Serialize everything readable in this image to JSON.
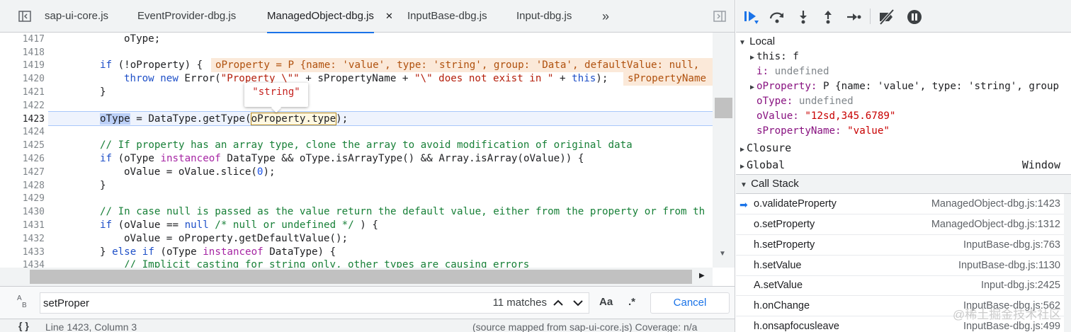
{
  "tabs": [
    {
      "label": "sap-ui-core.js"
    },
    {
      "label": "EventProvider-dbg.js"
    },
    {
      "label": "ManagedObject-dbg.js",
      "close": "✕"
    },
    {
      "label": "InputBase-dbg.js"
    },
    {
      "label": "Input-dbg.js"
    }
  ],
  "tabs_overflow": "»",
  "editor": {
    "line_numbers": [
      "1417",
      "1418",
      "1419",
      "1420",
      "1421",
      "1422",
      "1423",
      "1424",
      "1425",
      "1426",
      "1427",
      "1428",
      "1429",
      "1430",
      "1431",
      "1432",
      "1433",
      "1434"
    ],
    "inline_value_1": "oProperty = P {name: 'value', type: 'string', group: 'Data', defaultValue: null,",
    "inline_value_2": "sPropertyName",
    "tooltip": "\"string\"",
    "code": {
      "l1417": "oType;",
      "l1419a": "if",
      "l1419b": " (!oProperty) {",
      "l1420a": "throw new",
      "l1420b": " Error(",
      "l1420c": "\"Property \\\"\"",
      "l1420d": " + sPropertyName + ",
      "l1420e": "\"\\\" does not exist in \"",
      "l1420f": " + ",
      "l1420g": "this",
      "l1420h": ");",
      "l1421": "}",
      "l1423a": "oType",
      "l1423b": " = DataType.getType(",
      "l1423c": "oProperty.type",
      "l1423d": ");",
      "l1425": "// If property has an array type, clone the array to avoid modification of original data",
      "l1426a": "if",
      "l1426b": " (oType ",
      "l1426c": "instanceof",
      "l1426d": " DataType && oType.isArrayType() && Array.isArray(oValue)) {",
      "l1427a": "oValue = oValue.slice(",
      "l1427b": "0",
      "l1427c": ");",
      "l1428": "}",
      "l1430": "// In case null is passed as the value return the default value, either from the property or from th",
      "l1431a": "if",
      "l1431b": " (oValue == ",
      "l1431c": "null",
      "l1431d": " /* null or undefined */",
      "l1431e": " ) {",
      "l1432": "oValue = oProperty.getDefaultValue();",
      "l1433a": "} ",
      "l1433b": "else if",
      "l1433c": " (oType ",
      "l1433d": "instanceof",
      "l1433e": " DataType) {",
      "l1434": "// Implicit casting for string only, other types are causing errors"
    }
  },
  "search": {
    "icon_top": "A",
    "icon_bottom": "B",
    "value": "setProper",
    "matches": "11 matches",
    "case_label": "Aa",
    "regex_label": ".*",
    "cancel": "Cancel"
  },
  "status": {
    "braces": "{ }",
    "position": "Line 1423, Column 3",
    "source_map": "(source mapped from sap-ui-core.js) Coverage: n/a"
  },
  "scope": {
    "local_label": "Local",
    "rows": [
      {
        "name": "this",
        "value": "f",
        "expandable": true
      },
      {
        "name": "i",
        "value": "undefined",
        "kind": "u"
      },
      {
        "name": "oProperty",
        "value": "P {name: 'value', type: 'string', group",
        "expandable": true
      },
      {
        "name": "oType",
        "value": "undefined",
        "kind": "u"
      },
      {
        "name": "oValue",
        "value": "\"12sd,345.6789\"",
        "kind": "s"
      },
      {
        "name": "sPropertyName",
        "value": "\"value\"",
        "kind": "s"
      }
    ],
    "closure_label": "Closure",
    "global_label": "Global",
    "global_value": "Window"
  },
  "callstack": {
    "label": "Call Stack",
    "frames": [
      {
        "fn": "o.validateProperty",
        "loc": "ManagedObject-dbg.js:1423",
        "current": true
      },
      {
        "fn": "o.setProperty",
        "loc": "ManagedObject-dbg.js:1312"
      },
      {
        "fn": "h.setProperty",
        "loc": "InputBase-dbg.js:763"
      },
      {
        "fn": "h.setValue",
        "loc": "InputBase-dbg.js:1130"
      },
      {
        "fn": "A.setValue",
        "loc": "Input-dbg.js:2425"
      },
      {
        "fn": "h.onChange",
        "loc": "InputBase-dbg.js:562"
      },
      {
        "fn": "h.onsapfocusleave",
        "loc": "InputBase-dbg.js:499"
      }
    ]
  },
  "watermark": "@稀土掘金技术社区",
  "colors": {
    "accent": "#1a73e8",
    "keyword": "#1f50c8",
    "string": "#b5200d",
    "comment": "#188038"
  }
}
